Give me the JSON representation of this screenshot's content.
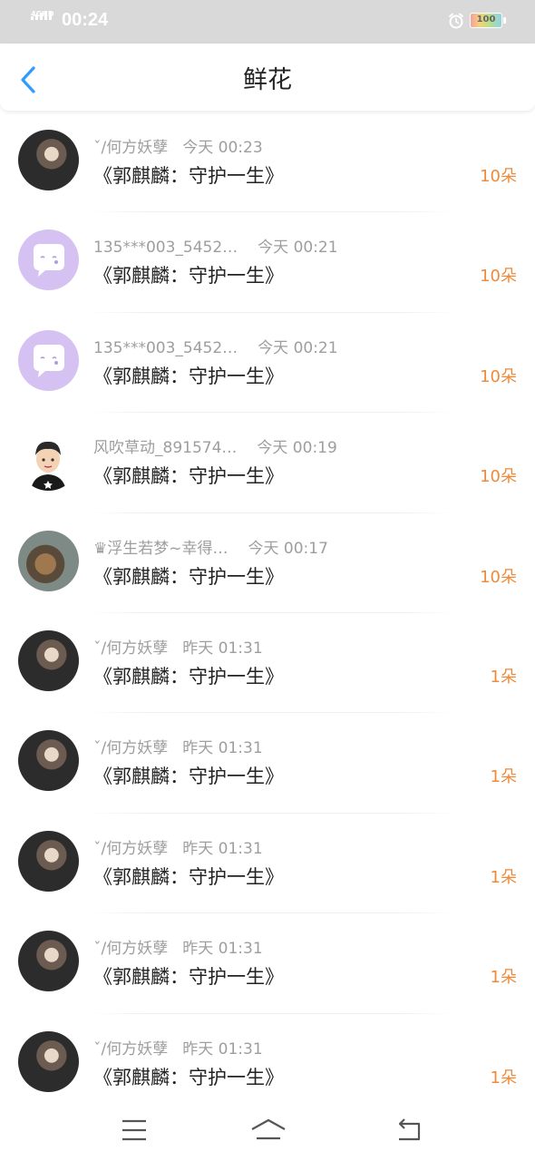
{
  "status_bar": {
    "network": "4GHD",
    "time": "00:24",
    "battery": "100"
  },
  "header": {
    "title": "鲜花",
    "back_icon": "chevron-left-icon"
  },
  "gifts": [
    {
      "user": "ˇ/何方妖孽",
      "time": "今天 00:23",
      "title": "《郭麒麟：守护一生》",
      "count": "10朵",
      "avatar": "photo"
    },
    {
      "user": "135***003_5452…",
      "time": "今天 00:21",
      "title": "《郭麒麟：守护一生》",
      "count": "10朵",
      "avatar": "purple"
    },
    {
      "user": "135***003_5452…",
      "time": "今天 00:21",
      "title": "《郭麒麟：守护一生》",
      "count": "10朵",
      "avatar": "purple"
    },
    {
      "user": "风吹草动_891574…",
      "time": "今天 00:19",
      "title": "《郭麒麟：守护一生》",
      "count": "10朵",
      "avatar": "cartoon"
    },
    {
      "user": "♛浮生若梦~幸得…",
      "time": "今天 00:17",
      "title": "《郭麒麟：守护一生》",
      "count": "10朵",
      "avatar": "bear"
    },
    {
      "user": "ˇ/何方妖孽",
      "time": "昨天 01:31",
      "title": "《郭麒麟：守护一生》",
      "count": "1朵",
      "avatar": "photo"
    },
    {
      "user": "ˇ/何方妖孽",
      "time": "昨天 01:31",
      "title": "《郭麒麟：守护一生》",
      "count": "1朵",
      "avatar": "photo"
    },
    {
      "user": "ˇ/何方妖孽",
      "time": "昨天 01:31",
      "title": "《郭麒麟：守护一生》",
      "count": "1朵",
      "avatar": "photo"
    },
    {
      "user": "ˇ/何方妖孽",
      "time": "昨天 01:31",
      "title": "《郭麒麟：守护一生》",
      "count": "1朵",
      "avatar": "photo"
    },
    {
      "user": "ˇ/何方妖孽",
      "time": "昨天 01:31",
      "title": "《郭麒麟：守护一生》",
      "count": "1朵",
      "avatar": "photo"
    }
  ],
  "bottom_nav": {
    "menu_icon": "menu-icon",
    "home_icon": "home-icon",
    "back_icon": "back-arrow-icon"
  },
  "colors": {
    "accent_blue": "#2f9bff",
    "count_orange": "#ef8a3a",
    "status_bar_bg": "#d9d9d9"
  }
}
